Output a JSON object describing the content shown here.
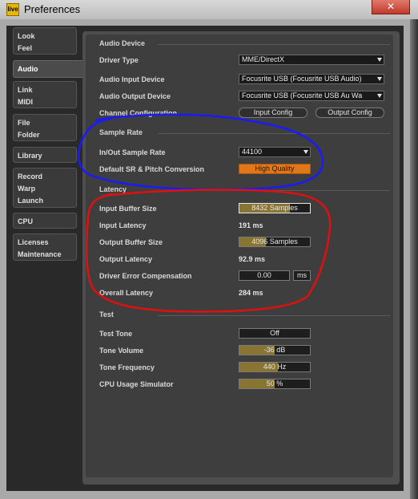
{
  "window": {
    "title": "Preferences",
    "app_icon_text": "live",
    "close_glyph": "✕"
  },
  "tabs": [
    {
      "lines": [
        "Look",
        "Feel"
      ]
    },
    {
      "lines": [
        "Audio"
      ],
      "active": true
    },
    {
      "lines": [
        "Link",
        "MIDI"
      ]
    },
    {
      "lines": [
        "File",
        "Folder"
      ]
    },
    {
      "lines": [
        "Library"
      ]
    },
    {
      "lines": [
        "Record",
        "Warp",
        "Launch"
      ]
    },
    {
      "lines": [
        "CPU"
      ]
    },
    {
      "lines": [
        "Licenses",
        "Maintenance"
      ]
    }
  ],
  "audio_device": {
    "heading": "Audio Device",
    "driver_type": {
      "label": "Driver Type",
      "value": "MME/DirectX"
    },
    "input_device": {
      "label": "Audio Input Device",
      "value": "Focusrite USB (Focusrite USB Audio)"
    },
    "output_device": {
      "label": "Audio Output Device",
      "value": "Focusrite USB (Focusrite USB Au Wa"
    },
    "channel_config": {
      "label": "Channel Configuration",
      "input_button": "Input Config",
      "output_button": "Output Config"
    }
  },
  "sample_rate": {
    "heading": "Sample Rate",
    "rate": {
      "label": "In/Out Sample Rate",
      "value": "44100"
    },
    "conversion": {
      "label": "Default SR & Pitch Conversion",
      "value": "High Quality"
    }
  },
  "latency": {
    "heading": "Latency",
    "input_buffer": {
      "label": "Input Buffer Size",
      "value": "8432 Samples",
      "fill": 0.72
    },
    "input_latency": {
      "label": "Input Latency",
      "value": "191 ms"
    },
    "output_buffer": {
      "label": "Output Buffer Size",
      "value": "4096 Samples",
      "fill": 0.38
    },
    "output_latency": {
      "label": "Output Latency",
      "value": "92.9 ms"
    },
    "driver_error": {
      "label": "Driver Error Compensation",
      "value": "0.00",
      "unit": "ms"
    },
    "overall": {
      "label": "Overall Latency",
      "value": "284 ms"
    }
  },
  "test": {
    "heading": "Test",
    "tone": {
      "label": "Test Tone",
      "value": "Off"
    },
    "volume": {
      "label": "Tone Volume",
      "value": "-36 dB",
      "fill": 0.5
    },
    "frequency": {
      "label": "Tone Frequency",
      "value": "440 Hz",
      "fill": 0.55
    },
    "cpu_sim": {
      "label": "CPU Usage Simulator",
      "value": "50 %",
      "fill": 0.5
    }
  },
  "colors": {
    "accent": "#e0781a",
    "fill": "#8a7431",
    "annotation_blue": "#1a1aff",
    "annotation_red": "#e01010"
  }
}
